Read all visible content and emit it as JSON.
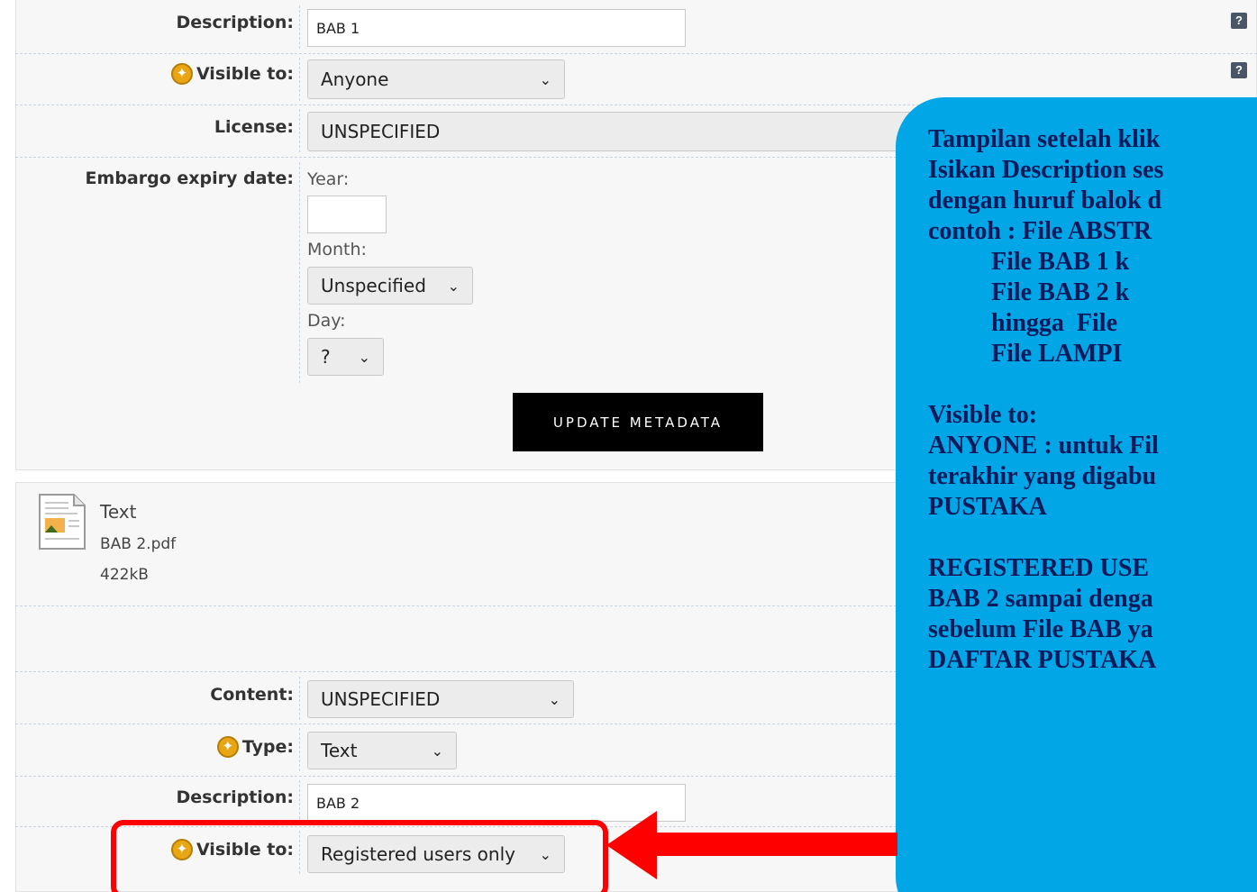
{
  "form_top": {
    "description_label": "Description:",
    "description_value": "BAB 1",
    "visible_label": "Visible to:",
    "visible_value": "Anyone",
    "license_label": "License:",
    "license_value": "UNSPECIFIED",
    "embargo_label": "Embargo expiry date:",
    "year_label": "Year:",
    "year_value": "",
    "month_label": "Month:",
    "month_value": "Unspecified",
    "day_label": "Day:",
    "day_value": "?",
    "update_button": "UPDATE METADATA"
  },
  "help_icon": "?",
  "file": {
    "icon": "pdf-document-icon",
    "type": "Text",
    "name": "BAB 2.pdf",
    "size": "422kB"
  },
  "form_bottom": {
    "content_label": "Content:",
    "content_value": "UNSPECIFIED",
    "type_label": "Type:",
    "type_value": "Text",
    "description_label": "Description:",
    "description_value": "BAB 2",
    "visible_label": "Visible to:",
    "visible_value": "Registered users only"
  },
  "callout": {
    "text": "Tampilan setelah klik\nIsikan Description ses\ndengan huruf balok d\ncontoh : File ABSTR\n          File BAB 1 k\n          File BAB 2 k\n          hingga  File \n          File LAMPI\n\nVisible to:\nANYONE : untuk Fil\nterakhir yang digabu\nPUSTAKA\n\nREGISTERED USE\nBAB 2 sampai denga\nsebelum File BAB ya\nDAFTAR PUSTAKA"
  },
  "colors": {
    "callout_bg": "#00a6e6",
    "highlight": "#ff0000",
    "button_bg": "#000000"
  }
}
